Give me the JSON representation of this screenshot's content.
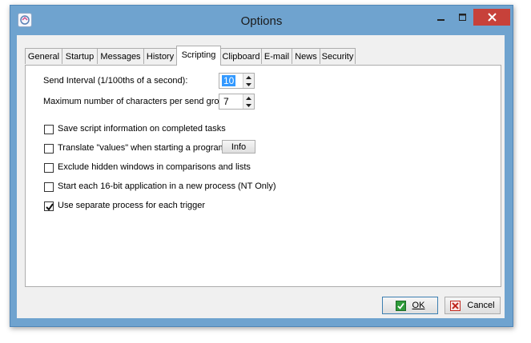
{
  "window": {
    "title": "Options"
  },
  "tabs": [
    {
      "label": "General"
    },
    {
      "label": "Startup"
    },
    {
      "label": "Messages"
    },
    {
      "label": "History"
    },
    {
      "label": "Scripting",
      "active": true
    },
    {
      "label": "Clipboard"
    },
    {
      "label": "E-mail"
    },
    {
      "label": "News"
    },
    {
      "label": "Security"
    }
  ],
  "scripting": {
    "send_interval_label": "Send Interval (1/100ths of a second):",
    "send_interval_value": "10",
    "max_chars_label": "Maximum number of characters per send group:",
    "max_chars_value": "7",
    "options": [
      {
        "label": "Save script information on completed tasks",
        "checked": false
      },
      {
        "label": "Translate \"values\" when starting a program",
        "checked": false
      },
      {
        "label": "Exclude hidden windows in comparisons and lists",
        "checked": false
      },
      {
        "label": "Start each 16-bit application in a new process (NT Only)",
        "checked": false
      },
      {
        "label": "Use separate process for each trigger",
        "checked": true
      }
    ],
    "info_button": "Info"
  },
  "footer": {
    "ok_label": "OK",
    "cancel_label": "Cancel"
  },
  "colors": {
    "frame": "#6fa3cf",
    "close": "#c7413a",
    "ok_check": "#2e9b3a",
    "cancel_x": "#c0281f"
  }
}
